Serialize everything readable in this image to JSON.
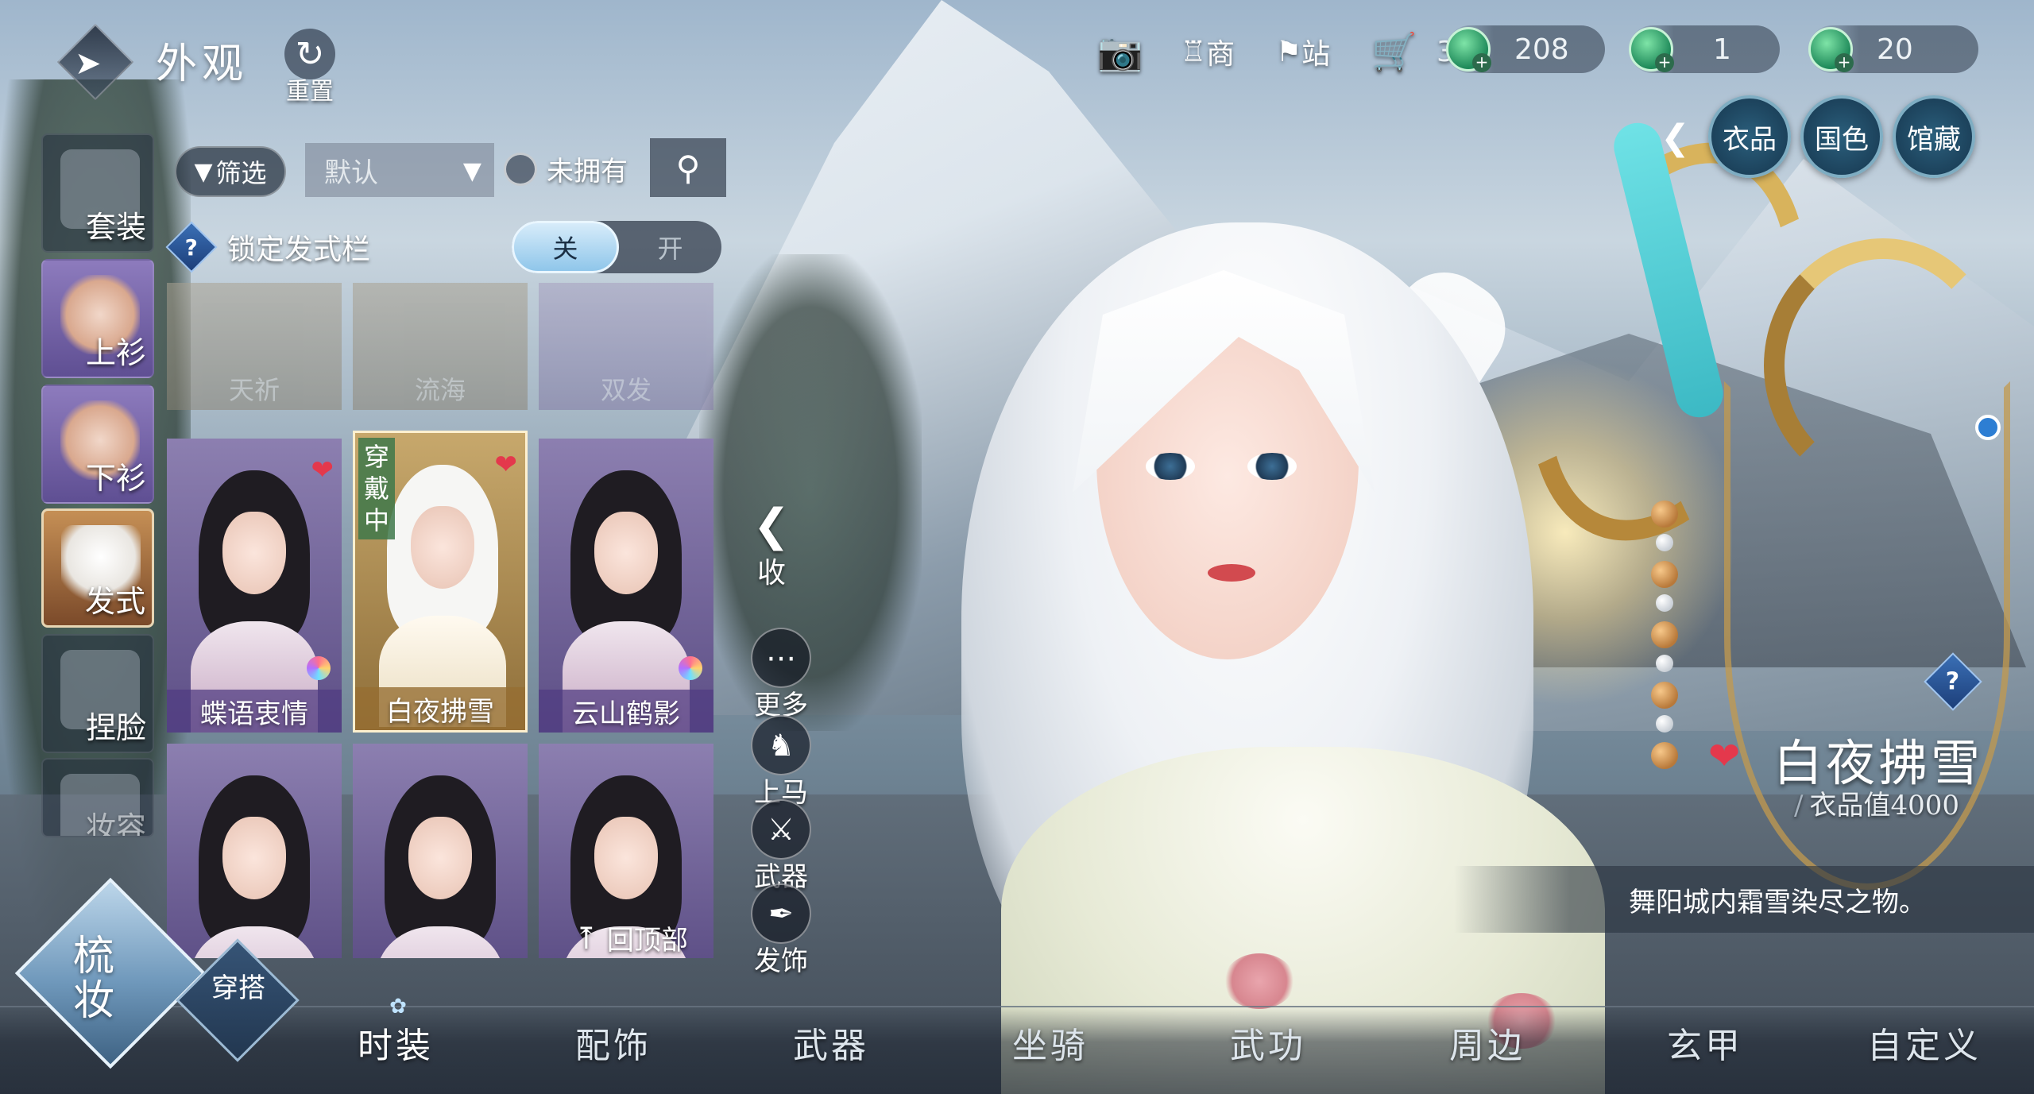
{
  "header": {
    "title": "外观",
    "reset_label": "重置"
  },
  "topbar": {
    "shop_label": "商",
    "station_label": "站",
    "cart_count": "3",
    "currencies": [
      {
        "icon": "jade-currency-icon",
        "value": "208"
      },
      {
        "icon": "jade-currency-icon",
        "value": "1"
      },
      {
        "icon": "jade-currency-icon",
        "value": "20"
      }
    ]
  },
  "right_tabs": [
    "衣品",
    "国色",
    "馆藏"
  ],
  "left_categories": [
    {
      "label": "套装"
    },
    {
      "label": "上衫"
    },
    {
      "label": "下衫"
    },
    {
      "label": "发式",
      "active": true
    },
    {
      "label": "捏脸"
    },
    {
      "label": "妆容"
    }
  ],
  "filter": {
    "filter_label": "筛选",
    "sort_value": "默认",
    "owned_label": "未拥有"
  },
  "lock_row": {
    "label": "锁定发式栏",
    "toggle_off": "关",
    "toggle_on": "开",
    "state": "关"
  },
  "grid": {
    "faded_row": [
      "天祈",
      "流海",
      "双发"
    ],
    "items": [
      {
        "name": "蝶语衷情",
        "favorite": true
      },
      {
        "name": "白夜拂雪",
        "favorite": true,
        "wearing": true,
        "wearing_label": "穿戴中"
      },
      {
        "name": "云山鹤影",
        "favorite": false
      }
    ],
    "back_to_top": "回顶部"
  },
  "side_actions": {
    "collapse": "收",
    "more": "更多",
    "mount": "上马",
    "weapon": "武器",
    "hair_accessory": "发饰"
  },
  "item_info": {
    "name": "白夜拂雪",
    "value_label": "衣品值4000",
    "description": "舞阳城内霜雪染尽之物。"
  },
  "modes": {
    "primary": "梳妆",
    "secondary": "穿搭"
  },
  "bottom_nav": [
    "时装",
    "配饰",
    "武器",
    "坐骑",
    "武功",
    "周边",
    "玄甲",
    "自定义"
  ],
  "bottom_nav_active": "时装"
}
